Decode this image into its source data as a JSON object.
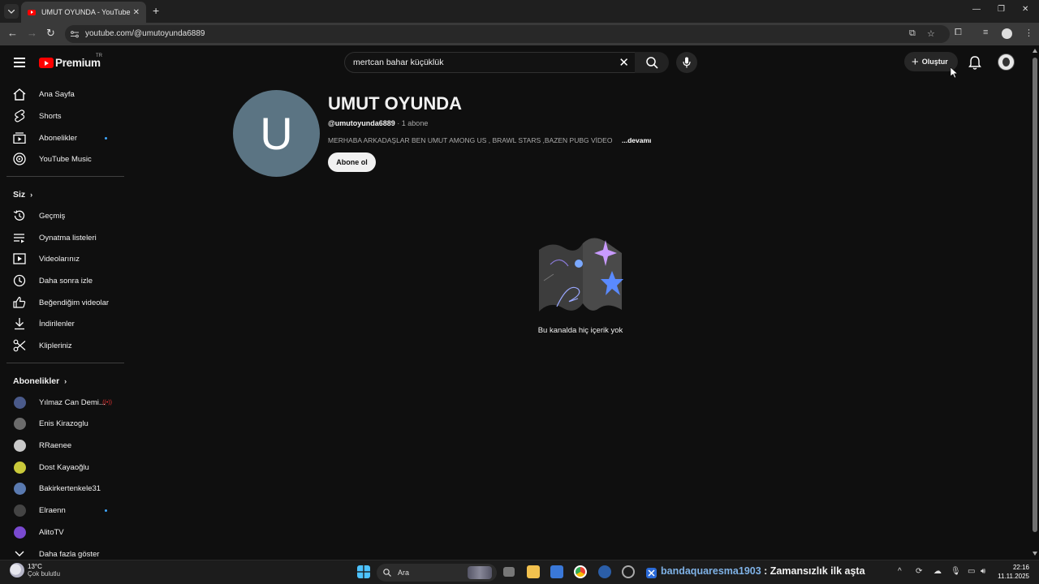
{
  "browser": {
    "tab_title": "UMUT OYUNDA - YouTube",
    "url": "youtube.com/@umutoyunda6889"
  },
  "header": {
    "logo_text": "Premium",
    "logo_region": "TR",
    "search_value": "mertcan bahar küçüklük",
    "create_label": "Oluştur"
  },
  "sidebar": {
    "main": [
      {
        "label": "Ana Sayfa",
        "icon": "home-icon"
      },
      {
        "label": "Shorts",
        "icon": "shorts-icon"
      },
      {
        "label": "Abonelikler",
        "icon": "subscriptions-icon",
        "new": true
      },
      {
        "label": "YouTube Music",
        "icon": "music-icon"
      }
    ],
    "you_title": "Siz",
    "you": [
      {
        "label": "Geçmiş",
        "icon": "history-icon"
      },
      {
        "label": "Oynatma listeleri",
        "icon": "playlists-icon"
      },
      {
        "label": "Videolarınız",
        "icon": "your-videos-icon"
      },
      {
        "label": "Daha sonra izle",
        "icon": "watch-later-icon"
      },
      {
        "label": "Beğendiğim videolar",
        "icon": "liked-icon"
      },
      {
        "label": "İndirilenler",
        "icon": "download-icon"
      },
      {
        "label": "Klipleriniz",
        "icon": "clips-icon"
      }
    ],
    "subs_title": "Abonelikler",
    "subs": [
      {
        "label": "Yılmaz Can Demi...",
        "color": "#4a5a8a",
        "live": true
      },
      {
        "label": "Enis Kirazoglu",
        "color": "#6b6b6b"
      },
      {
        "label": "RRaenee",
        "color": "#c9c9c9"
      },
      {
        "label": "Dost Kayaoğlu",
        "color": "#c9c93a"
      },
      {
        "label": "Bakirkertenkele31",
        "color": "#5a7ab0"
      },
      {
        "label": "Elraenn",
        "color": "#444444",
        "new": true
      },
      {
        "label": "AlitoTV",
        "color": "#7a4ad0"
      }
    ],
    "show_more": "Daha fazla göster"
  },
  "channel": {
    "avatar_letter": "U",
    "avatar_color": "#5b7483",
    "name": "UMUT OYUNDA",
    "handle": "@umutoyunda6889",
    "subscribers": " · 1 abone",
    "description": "MERHABA ARKADAŞLAR BEN UMUT AMONG US , BRAWL STARS ,BAZEN PUBG VİDEO",
    "more": "...devamı",
    "subscribe_label": "Abone ol",
    "empty_text": "Bu kanalda hiç içerik yok"
  },
  "taskbar": {
    "temp": "13°C",
    "weather": "Çok bulutlu",
    "search_label": "Ara",
    "stream_user": "bandaquaresma1903",
    "stream_msg": " : Zamansızlık ilk aşta",
    "time": "22:16",
    "date": "11.11.2025"
  },
  "colors": {
    "accent": "#ff0000",
    "background": "#0f0f0f",
    "link_blue": "#3ea6ff"
  }
}
